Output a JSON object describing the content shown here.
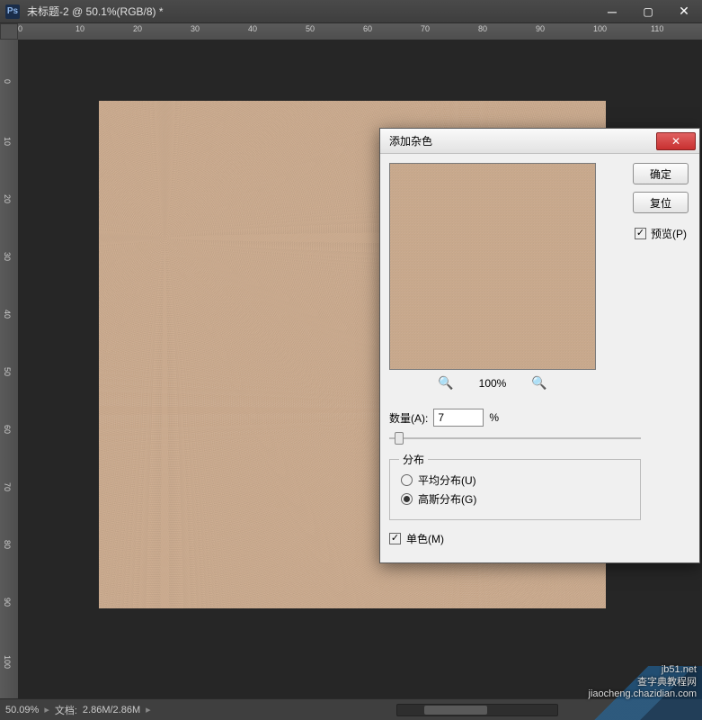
{
  "window": {
    "title": "未标题-2 @ 50.1%(RGB/8) *"
  },
  "ruler_h": [
    0,
    10,
    20,
    30,
    40,
    50,
    60,
    70,
    80,
    90,
    100,
    110
  ],
  "ruler_v": [
    10,
    0,
    10,
    20,
    30,
    40,
    50,
    60,
    70,
    80,
    90,
    100
  ],
  "status": {
    "zoom": "50.09%",
    "doc_label": "文档:",
    "doc_value": "2.86M/2.86M"
  },
  "dialog": {
    "title": "添加杂色",
    "ok": "确定",
    "reset": "复位",
    "preview_label": "预览(P)",
    "zoom_percent": "100%",
    "amount_label": "数量(A):",
    "amount_value": "7",
    "amount_unit": "%",
    "distribution_legend": "分布",
    "uniform_label": "平均分布(U)",
    "gaussian_label": "高斯分布(G)",
    "mono_label": "单色(M)"
  },
  "watermark": {
    "line1": "查字典教程网",
    "line2": "jiaocheng.chazidian.com",
    "line3": "jb51.net"
  },
  "colors": {
    "canvas": "#cdab8d",
    "workarea": "#262626"
  }
}
